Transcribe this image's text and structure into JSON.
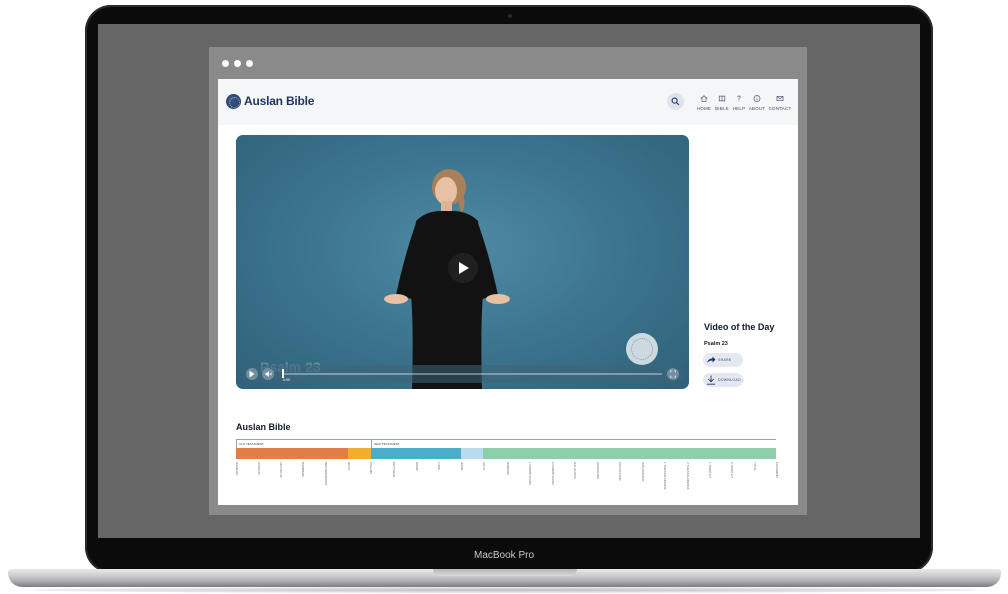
{
  "device": {
    "model": "MacBook Pro"
  },
  "header": {
    "logo": "Auslan Bible",
    "nav": [
      {
        "label": "HOME",
        "icon": "home-icon"
      },
      {
        "label": "BIBLE",
        "icon": "book-icon"
      },
      {
        "label": "HELP",
        "icon": "help-icon"
      },
      {
        "label": "ABOUT",
        "icon": "info-icon"
      },
      {
        "label": "CONTACT",
        "icon": "mail-icon"
      }
    ]
  },
  "video": {
    "title": "Psalm 23",
    "time": "0:00",
    "progress": 0
  },
  "votd": {
    "heading": "Video of the Day",
    "subtitle": "Psalm 23",
    "share_label": "SHARE",
    "download_label": "DOWNLOAD"
  },
  "bible": {
    "heading": "Auslan Bible",
    "old_label": "OLD TESTAMENT",
    "new_label": "NEW TESTAMENT",
    "colors": {
      "orange": "#e27e45",
      "yellow": "#f2ad2e",
      "blue": "#4aaecb",
      "lightblue": "#b9dcec",
      "green": "#8bd0aa"
    },
    "books": [
      "GENESIS",
      "EXODUS",
      "LEVITICUS",
      "NUMBERS",
      "DEUTERONOMY",
      "RUTH",
      "PSALMS",
      "MATTHEW",
      "MARK",
      "LUKE",
      "JOHN",
      "ACTS",
      "ROMANS",
      "1 CORINTHIANS",
      "2 CORINTHIANS",
      "GALATIANS",
      "EPHESIANS",
      "PHILIPPIANS",
      "COLOSSIANS",
      "1 THESSALONIANS",
      "2 THESSALONIANS",
      "1 TIMOTHY",
      "2 TIMOTHY",
      "TITUS",
      "PHILEMON"
    ]
  }
}
